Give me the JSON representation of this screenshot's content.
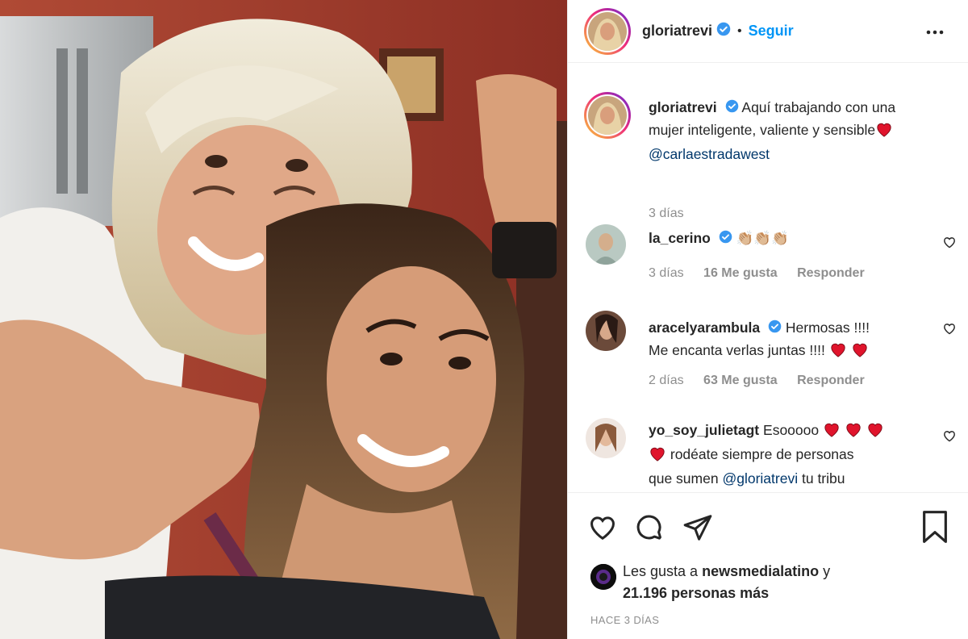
{
  "post": {
    "username": "gloriatrevi",
    "follow_label": "Seguir",
    "separator": "•"
  },
  "caption": {
    "username": "gloriatrevi",
    "text_line1": "Aquí trabajando con una",
    "text_line2": "mujer inteligente, valiente y sensible",
    "mention": "@carlaestradawest",
    "time": "3 días"
  },
  "comments": [
    {
      "username": "la_cerino",
      "verified": true,
      "text": "",
      "emoji": "👏🏼👏🏼👏🏼",
      "time": "3 días",
      "likes": "16 Me gusta",
      "reply": "Responder"
    },
    {
      "username": "aracelyarambula",
      "verified": true,
      "text_line1": "Hermosas !!!!",
      "text_line2": "Me encanta verlas juntas !!!!",
      "time": "2 días",
      "likes": "63 Me gusta",
      "reply": "Responder"
    },
    {
      "username": "yo_soy_julietagt",
      "verified": false,
      "text_line1": "Esooooo",
      "text_line2": "rodéate siempre de personas",
      "text_line3": "que sumen",
      "mention": "@gloriatrevi",
      "text_line3_end": "tu tribu"
    }
  ],
  "likes": {
    "prefix": "Les gusta a",
    "user": "newsmedialatino",
    "conj": "y",
    "count": "21.196 personas más"
  },
  "time_ago": "HACE 3 DÍAS",
  "colors": {
    "follow": "#0095f6",
    "verified": "#3897f0",
    "heart": "#e0142c",
    "muted": "#8e8e8e",
    "mention": "#00376b"
  },
  "icons": [
    "verified-badge-icon",
    "more-options-icon",
    "heart-icon",
    "comment-icon",
    "share-icon",
    "bookmark-icon",
    "like-comment-icon"
  ]
}
